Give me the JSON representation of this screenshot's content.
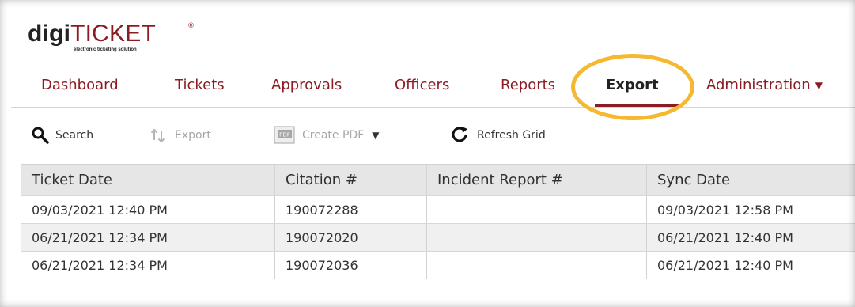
{
  "logo": {
    "brand_primary": "digi",
    "brand_secondary": "TICKET",
    "registered_mark": "®",
    "tagline": "electronic ticketing solution"
  },
  "nav": {
    "items": [
      {
        "label": "Dashboard"
      },
      {
        "label": "Tickets"
      },
      {
        "label": "Approvals"
      },
      {
        "label": "Officers"
      },
      {
        "label": "Reports"
      },
      {
        "label": "Export",
        "active": true
      },
      {
        "label": "Administration",
        "has_dropdown": true
      }
    ],
    "active_tab": "Export"
  },
  "toolbar": {
    "search_label": "Search",
    "export_label": "Export",
    "create_pdf_label": "Create PDF",
    "refresh_label": "Refresh Grid",
    "pdf_badge": "PDF",
    "dropdown_caret": "▼",
    "search_enabled": true,
    "export_enabled": false,
    "create_pdf_enabled": false,
    "refresh_enabled": true
  },
  "grid": {
    "columns": [
      "Ticket Date",
      "Citation #",
      "Incident Report #",
      "Sync Date"
    ],
    "rows": [
      [
        "09/03/2021 12:40 PM",
        "190072288",
        "",
        "09/03/2021 12:58 PM"
      ],
      [
        "06/21/2021 12:34 PM",
        "190072020",
        "",
        "06/21/2021 12:40 PM"
      ],
      [
        "06/21/2021 12:34 PM",
        "190072036",
        "",
        "06/21/2021 12:40 PM"
      ]
    ]
  },
  "colors": {
    "brand_red": "#8b1c24",
    "highlight_yellow": "#f5b82e",
    "header_gray": "#e6e6e6",
    "alternate_row_gray": "#f0f0f0",
    "selected_row_border": "#b9d7ef"
  },
  "icons": {
    "search": "search-icon",
    "export": "export-icon",
    "pdf": "pdf-icon",
    "refresh": "refresh-icon",
    "dropdown": "chevron-down-icon"
  }
}
